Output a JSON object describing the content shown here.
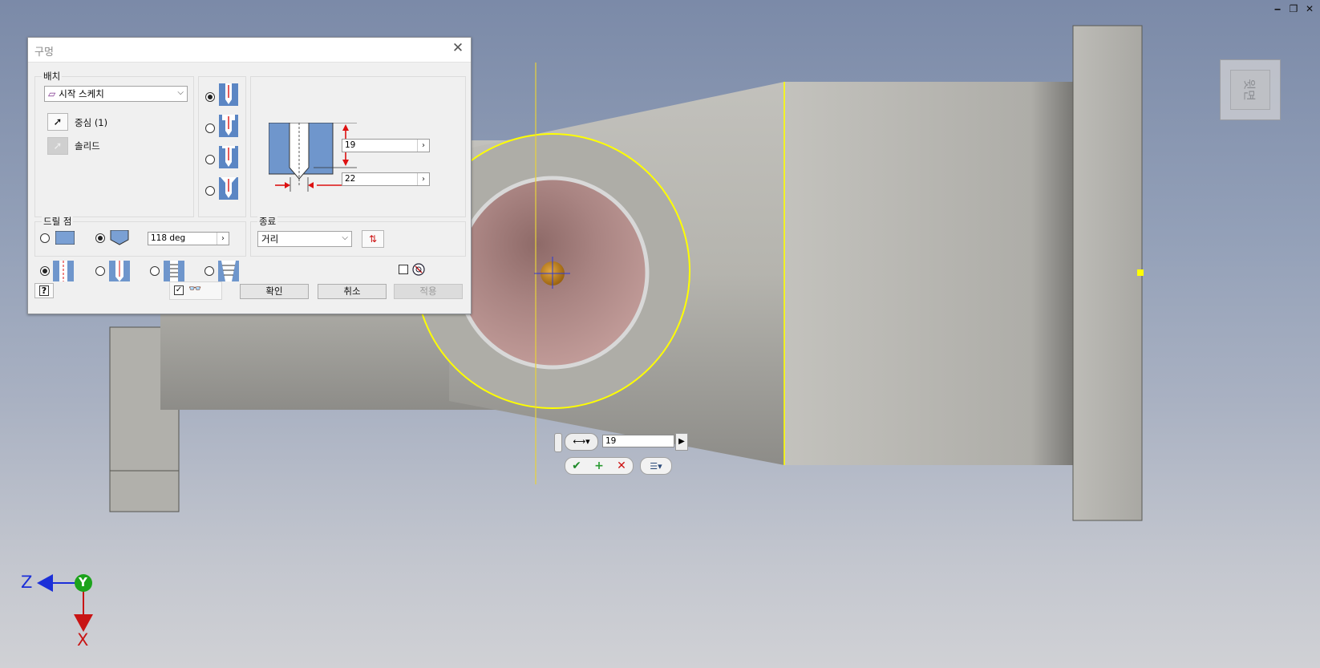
{
  "dialog": {
    "title": "구멍",
    "placement": {
      "label": "배치",
      "type_value": "시작 스케치",
      "center_label": "중심 (1)",
      "solid_label": "솔리드"
    },
    "dimensions": {
      "depth_value": "19",
      "diameter_value": "22"
    },
    "drill_point": {
      "label": "드릴 점",
      "angle_value": "118 deg"
    },
    "termination": {
      "label": "종료",
      "value": "거리"
    },
    "buttons": {
      "ok": "확인",
      "cancel": "취소",
      "apply": "적용"
    }
  },
  "mini_toolbar": {
    "value": "19"
  },
  "view_cube": {
    "face_label": "윗면"
  },
  "axes": {
    "z": "Z",
    "y": "Y",
    "x": "X"
  },
  "colors": {
    "selection": "#ffff00",
    "hole_interior": "#b48a88",
    "part": "#b9b8b2",
    "axis_z": "#1b2fd8",
    "axis_y": "#1ca31c",
    "axis_x": "#c81414"
  }
}
